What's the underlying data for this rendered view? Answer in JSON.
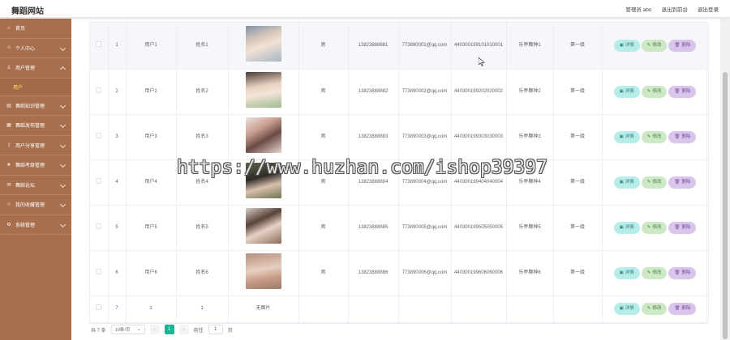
{
  "app": {
    "brand": "舞蹈网站",
    "top_nav": [
      "管理员 abo",
      "退出到前台",
      "退出登录"
    ]
  },
  "sidebar": {
    "items": [
      {
        "label": "首页",
        "icon": "home-icon",
        "has_children": false
      },
      {
        "label": "个人中心",
        "icon": "user-icon",
        "has_children": true
      },
      {
        "label": "用户管理",
        "icon": "users-icon",
        "has_children": true,
        "expanded": true,
        "children": [
          "用户"
        ]
      },
      {
        "label": "舞蹈知识管理",
        "icon": "book-icon",
        "has_children": true
      },
      {
        "label": "舞蹈发布管理",
        "icon": "publish-icon",
        "has_children": true
      },
      {
        "label": "用户分享管理",
        "icon": "share-icon",
        "has_children": true
      },
      {
        "label": "舞蹈考级管理",
        "icon": "grade-icon",
        "has_children": true
      },
      {
        "label": "舞蹈论坛",
        "icon": "forum-icon",
        "has_children": true
      },
      {
        "label": "我的收藏管理",
        "icon": "star-icon",
        "has_children": true
      },
      {
        "label": "系统管理",
        "icon": "gear-icon",
        "has_children": true
      }
    ]
  },
  "table": {
    "rows": [
      {
        "index": "1",
        "account": "用户1",
        "name": "姓名1",
        "has_photo": true,
        "photo_empty_text": "",
        "gender": "男",
        "phone": "13823888881",
        "email": "773890001@qq.com",
        "id_card": "440300199101010001",
        "dance_type": "乐亭舞种1",
        "level": "第一级"
      },
      {
        "index": "2",
        "account": "用户2",
        "name": "姓名2",
        "has_photo": true,
        "photo_empty_text": "",
        "gender": "男",
        "phone": "13823888882",
        "email": "773890002@qq.com",
        "id_card": "440300199202020002",
        "dance_type": "乐亭舞种2",
        "level": "第一级"
      },
      {
        "index": "3",
        "account": "用户3",
        "name": "姓名3",
        "has_photo": true,
        "photo_empty_text": "",
        "gender": "男",
        "phone": "13823888883",
        "email": "773890003@qq.com",
        "id_card": "440300199303030003",
        "dance_type": "乐亭舞种3",
        "level": "第一级"
      },
      {
        "index": "4",
        "account": "用户4",
        "name": "姓名4",
        "has_photo": true,
        "photo_empty_text": "",
        "gender": "男",
        "phone": "13823888884",
        "email": "773890004@qq.com",
        "id_card": "440300199404040004",
        "dance_type": "乐亭舞种4",
        "level": "第一级"
      },
      {
        "index": "5",
        "account": "用户5",
        "name": "姓名5",
        "has_photo": true,
        "photo_empty_text": "",
        "gender": "男",
        "phone": "13823888885",
        "email": "773890005@qq.com",
        "id_card": "440300199505050005",
        "dance_type": "乐亭舞种5",
        "level": "第一级"
      },
      {
        "index": "6",
        "account": "用户6",
        "name": "姓名6",
        "has_photo": true,
        "photo_empty_text": "",
        "gender": "男",
        "phone": "13823888886",
        "email": "773890006@qq.com",
        "id_card": "440300199606060006",
        "dance_type": "乐亭舞种6",
        "level": "第一级"
      },
      {
        "index": "7",
        "account": "1",
        "name": "1",
        "has_photo": false,
        "photo_empty_text": "无图片",
        "gender": "",
        "phone": "",
        "email": "",
        "id_card": "",
        "dance_type": "",
        "level": ""
      }
    ],
    "actions": {
      "detail": "详情",
      "edit": "修改",
      "delete": "删除"
    }
  },
  "pagination": {
    "total_text": "共 7 条",
    "page_size": "10条/页",
    "current_page": "1",
    "goto_label": "前往",
    "goto_value": "1",
    "page_unit": "页"
  },
  "watermark": "https://www.huzhan.com/ishop39397",
  "colors": {
    "sidebar_bg": "#a86f4e",
    "active_submenu": "#ffe34d",
    "page_active": "#1ab394",
    "btn_detail": "#b6ece9",
    "btn_edit": "#cde8c5",
    "btn_delete": "#d9c4ea"
  }
}
